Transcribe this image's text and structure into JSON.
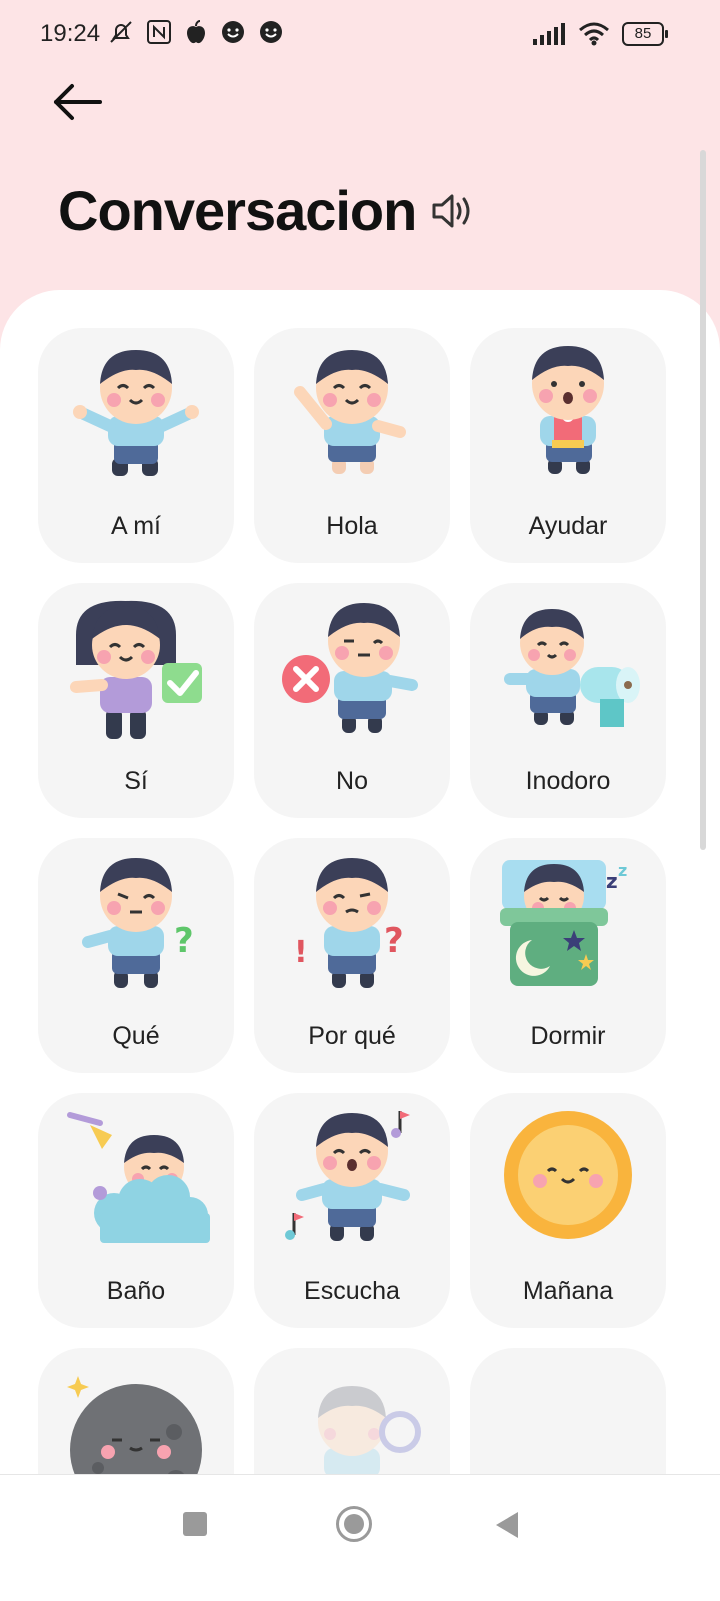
{
  "status": {
    "time": "19:24",
    "battery": "85",
    "left_icons": [
      "bell-off-icon",
      "nfc-icon",
      "apple-icon",
      "face-icon",
      "face-icon"
    ],
    "right_icons": [
      "signal-icon",
      "wifi-icon",
      "battery-icon"
    ]
  },
  "header": {
    "back_icon": "arrow-left-icon",
    "title": "Conversacion",
    "speaker_icon": "speaker-icon"
  },
  "cards": [
    {
      "label": "A mí",
      "icon": "child-happy-icon"
    },
    {
      "label": "Hola",
      "icon": "child-wave-icon"
    },
    {
      "label": "Ayudar",
      "icon": "child-help-icon"
    },
    {
      "label": "Sí",
      "icon": "child-yes-icon"
    },
    {
      "label": "No",
      "icon": "child-no-icon"
    },
    {
      "label": "Inodoro",
      "icon": "child-toilet-paper-icon"
    },
    {
      "label": "Qué",
      "icon": "child-question-icon"
    },
    {
      "label": "Por qué",
      "icon": "child-why-icon"
    },
    {
      "label": "Dormir",
      "icon": "child-sleep-icon"
    },
    {
      "label": "Baño",
      "icon": "child-bath-icon"
    },
    {
      "label": "Escucha",
      "icon": "child-listen-icon"
    },
    {
      "label": "Mañana",
      "icon": "sun-icon"
    },
    {
      "label": "",
      "icon": "moon-icon"
    },
    {
      "label": "",
      "icon": "child-plate-icon"
    },
    {
      "label": "",
      "icon": ""
    }
  ],
  "colors": {
    "header_bg": "#fde4e6",
    "card_bg": "#f5f5f5",
    "text": "#111111"
  }
}
